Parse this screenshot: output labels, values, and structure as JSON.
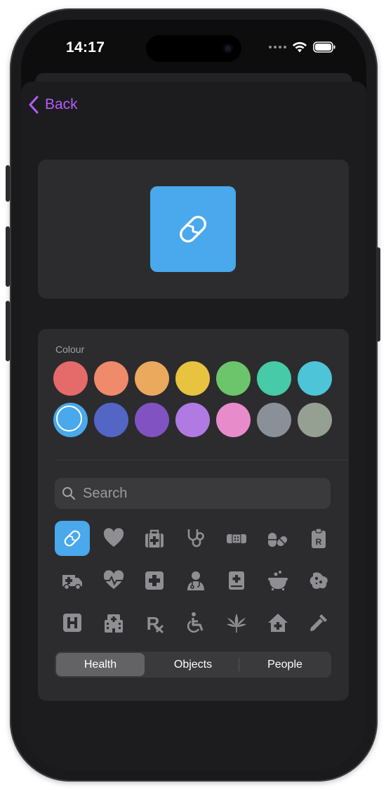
{
  "status_bar": {
    "time": "14:17"
  },
  "nav": {
    "back_label": "Back"
  },
  "preview": {
    "icon": "pill-icon",
    "color": "#4aa8ec"
  },
  "colour_section": {
    "label": "Colour",
    "swatches": [
      {
        "color": "#e56a6a"
      },
      {
        "color": "#ef8a6b"
      },
      {
        "color": "#eba95d"
      },
      {
        "color": "#e8c33f"
      },
      {
        "color": "#6cc56a"
      },
      {
        "color": "#47caa7"
      },
      {
        "color": "#4dc4d8"
      },
      {
        "color": "#4aa8ec",
        "selected": true
      },
      {
        "color": "#5366c6"
      },
      {
        "color": "#8153c2"
      },
      {
        "color": "#b07ae2"
      },
      {
        "color": "#e88bcb"
      },
      {
        "color": "#8a9098"
      },
      {
        "color": "#95a092"
      }
    ]
  },
  "search": {
    "placeholder": "Search"
  },
  "icons": [
    "pill-icon",
    "heart-icon",
    "medical-bag-icon",
    "stethoscope-icon",
    "bandage-icon",
    "pills-icon",
    "prescription-clipboard-icon",
    "ambulance-icon",
    "heart-pulse-icon",
    "medical-cross-icon",
    "doctor-icon",
    "medical-book-icon",
    "cauldron-icon",
    "virus-icon",
    "hospital-sign-icon",
    "hospital-building-icon",
    "rx-icon",
    "wheelchair-icon",
    "cannabis-leaf-icon",
    "house-medical-icon",
    "eyedropper-icon"
  ],
  "segments": {
    "items": [
      "Health",
      "Objects",
      "People"
    ],
    "active": "Health"
  }
}
